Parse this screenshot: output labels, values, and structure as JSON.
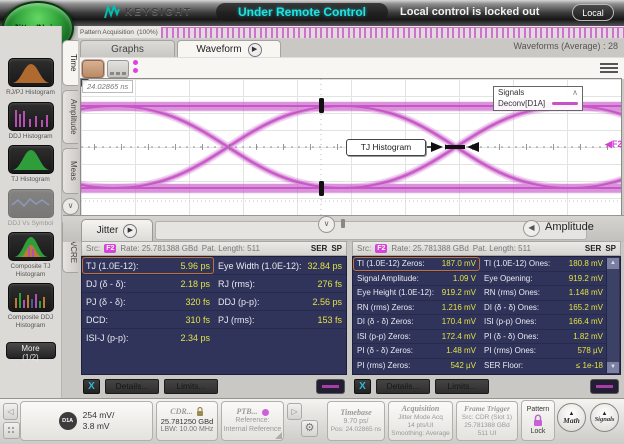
{
  "colors": {
    "accent_magenta": "#c653c6",
    "value_yellow": "#e3e345",
    "panel_navy": "#30345a",
    "remote_cyan": "#1fe4e4",
    "selection_orange": "#c0703a"
  },
  "titlebar": {
    "app_button": "Jitter/Noise",
    "brand": "KEYSIGHT",
    "remote_status": "Under Remote Control",
    "lock_message": "Local control is locked out",
    "local_button": "Local"
  },
  "acq_bar": {
    "label": "Pattern Acquisition",
    "percent": "(100%)",
    "waveforms_counter": "Waveforms (Average) : 28"
  },
  "sidebar": {
    "items": [
      {
        "label": "RJ/PJ Histogram"
      },
      {
        "label": "DDJ Histogram"
      },
      {
        "label": "TJ Histogram"
      },
      {
        "label": "DDJ Vs Symbol"
      },
      {
        "label": "Composite TJ Histogram"
      },
      {
        "label": "Composite DDJ Histogram"
      }
    ],
    "more_button": "More (1/2)"
  },
  "main_tabs": {
    "graphs": "Graphs",
    "waveform": "Waveform"
  },
  "side_tabs": {
    "time": "Time",
    "amplitude": "Amplitude",
    "meas": "Meas",
    "xsa_cre": "XSA/CRE"
  },
  "plot": {
    "timebase_label": "24.02865 ns",
    "legend_title": "Signals",
    "legend_entry": "Deconv[D1A]",
    "annotation": "TJ Histogram",
    "marker_arrow": "◀",
    "marker_label": "F2"
  },
  "split_bar": {
    "left_tab": "Jitter",
    "right_tab": "Amplitude"
  },
  "jitter": {
    "src_label": "Src:",
    "src_badge": "F2",
    "rate": "Rate: 25.781388 GBd",
    "pat_length": "Pat. Length: 511",
    "ser": "SER",
    "sp": "SP",
    "rows": [
      [
        {
          "l": "TJ (1.0E-12):",
          "v": "5.96 ps"
        },
        {
          "l": "Eye Width (1.0E-12):",
          "v": "32.84 ps"
        }
      ],
      [
        {
          "l": "DJ (δ - δ):",
          "v": "2.18 ps"
        },
        {
          "l": "RJ (rms):",
          "v": "276 fs"
        }
      ],
      [
        {
          "l": "PJ (δ - δ):",
          "v": "320 fs"
        },
        {
          "l": "DDJ (p-p):",
          "v": "2.56 ps"
        }
      ],
      [
        {
          "l": "DCD:",
          "v": "310 fs"
        },
        {
          "l": "PJ (rms):",
          "v": "153 fs"
        }
      ],
      [
        {
          "l": "ISI-J (p-p):",
          "v": "2.34 ps"
        },
        {
          "l": "",
          "v": ""
        }
      ]
    ],
    "buttons": {
      "x": "X",
      "details": "Details...",
      "limits": "Limits..."
    }
  },
  "amplitude": {
    "src_label": "Src:",
    "src_badge": "F2",
    "rate": "Rate: 25.781388 GBd",
    "pat_length": "Pat. Length: 511",
    "ser": "SER",
    "sp": "SP",
    "rows": [
      [
        {
          "l": "TI (1.0E-12) Zeros:",
          "v": "187.0 mV"
        },
        {
          "l": "TI (1.0E-12) Ones:",
          "v": "180.8 mV"
        }
      ],
      [
        {
          "l": "Signal Amplitude:",
          "v": "1.09 V"
        },
        {
          "l": "Eye Opening:",
          "v": "919.2 mV"
        }
      ],
      [
        {
          "l": "Eye Height (1.0E-12):",
          "v": "919.2 mV"
        },
        {
          "l": "RN (rms) Ones:",
          "v": "1.148 mV"
        }
      ],
      [
        {
          "l": "RN (rms) Zeros:",
          "v": "1.216 mV"
        },
        {
          "l": "DI (δ - δ) Ones:",
          "v": "165.2 mV"
        }
      ],
      [
        {
          "l": "DI (δ - δ) Zeros:",
          "v": "170.4 mV"
        },
        {
          "l": "ISI (p-p) Ones:",
          "v": "166.4 mV"
        }
      ],
      [
        {
          "l": "ISI (p-p) Zeros:",
          "v": "172.4 mV"
        },
        {
          "l": "PI (δ - δ) Ones:",
          "v": "1.82 mV"
        }
      ],
      [
        {
          "l": "PI (δ - δ) Zeros:",
          "v": "1.48 mV"
        },
        {
          "l": "PI (rms) Ones:",
          "v": "578 µV"
        }
      ],
      [
        {
          "l": "PI (rms) Zeros:",
          "v": "542 µV"
        },
        {
          "l": "SER Floor:",
          "v": "≤ 1e-18"
        }
      ]
    ],
    "buttons": {
      "x": "X",
      "details": "Details...",
      "limits": "Limits..."
    }
  },
  "statusbar": {
    "channel": {
      "badge": "D1A",
      "scale": "254 mV/",
      "offset": "3.8 mV"
    },
    "cdr": {
      "title": "CDR...",
      "rate": "25.781250 GBd",
      "lbw": "LBW: 10.00 MHz"
    },
    "ptb": {
      "title": "PTB...",
      "line1": "Reference:",
      "line2": "Internal Reference"
    },
    "timebase": {
      "title": "Timebase",
      "scale": "9.70 ps/",
      "position": "Pos: 24.02865 ns"
    },
    "acquisition": {
      "title": "Acquisition",
      "line1": "Jitter Mode Acq",
      "line2": "14 pts/UI",
      "line3": "Smoothing: Average"
    },
    "frame_trigger": {
      "title": "Frame Trigger",
      "line1": "Src: CDR (Slot 1)",
      "line2": "25.781388 GBd",
      "line3": "511 UI"
    },
    "pattern_lock": {
      "line1": "Pattern",
      "line2": "Lock"
    },
    "math_button": "Math",
    "signals_button": "Signals"
  }
}
